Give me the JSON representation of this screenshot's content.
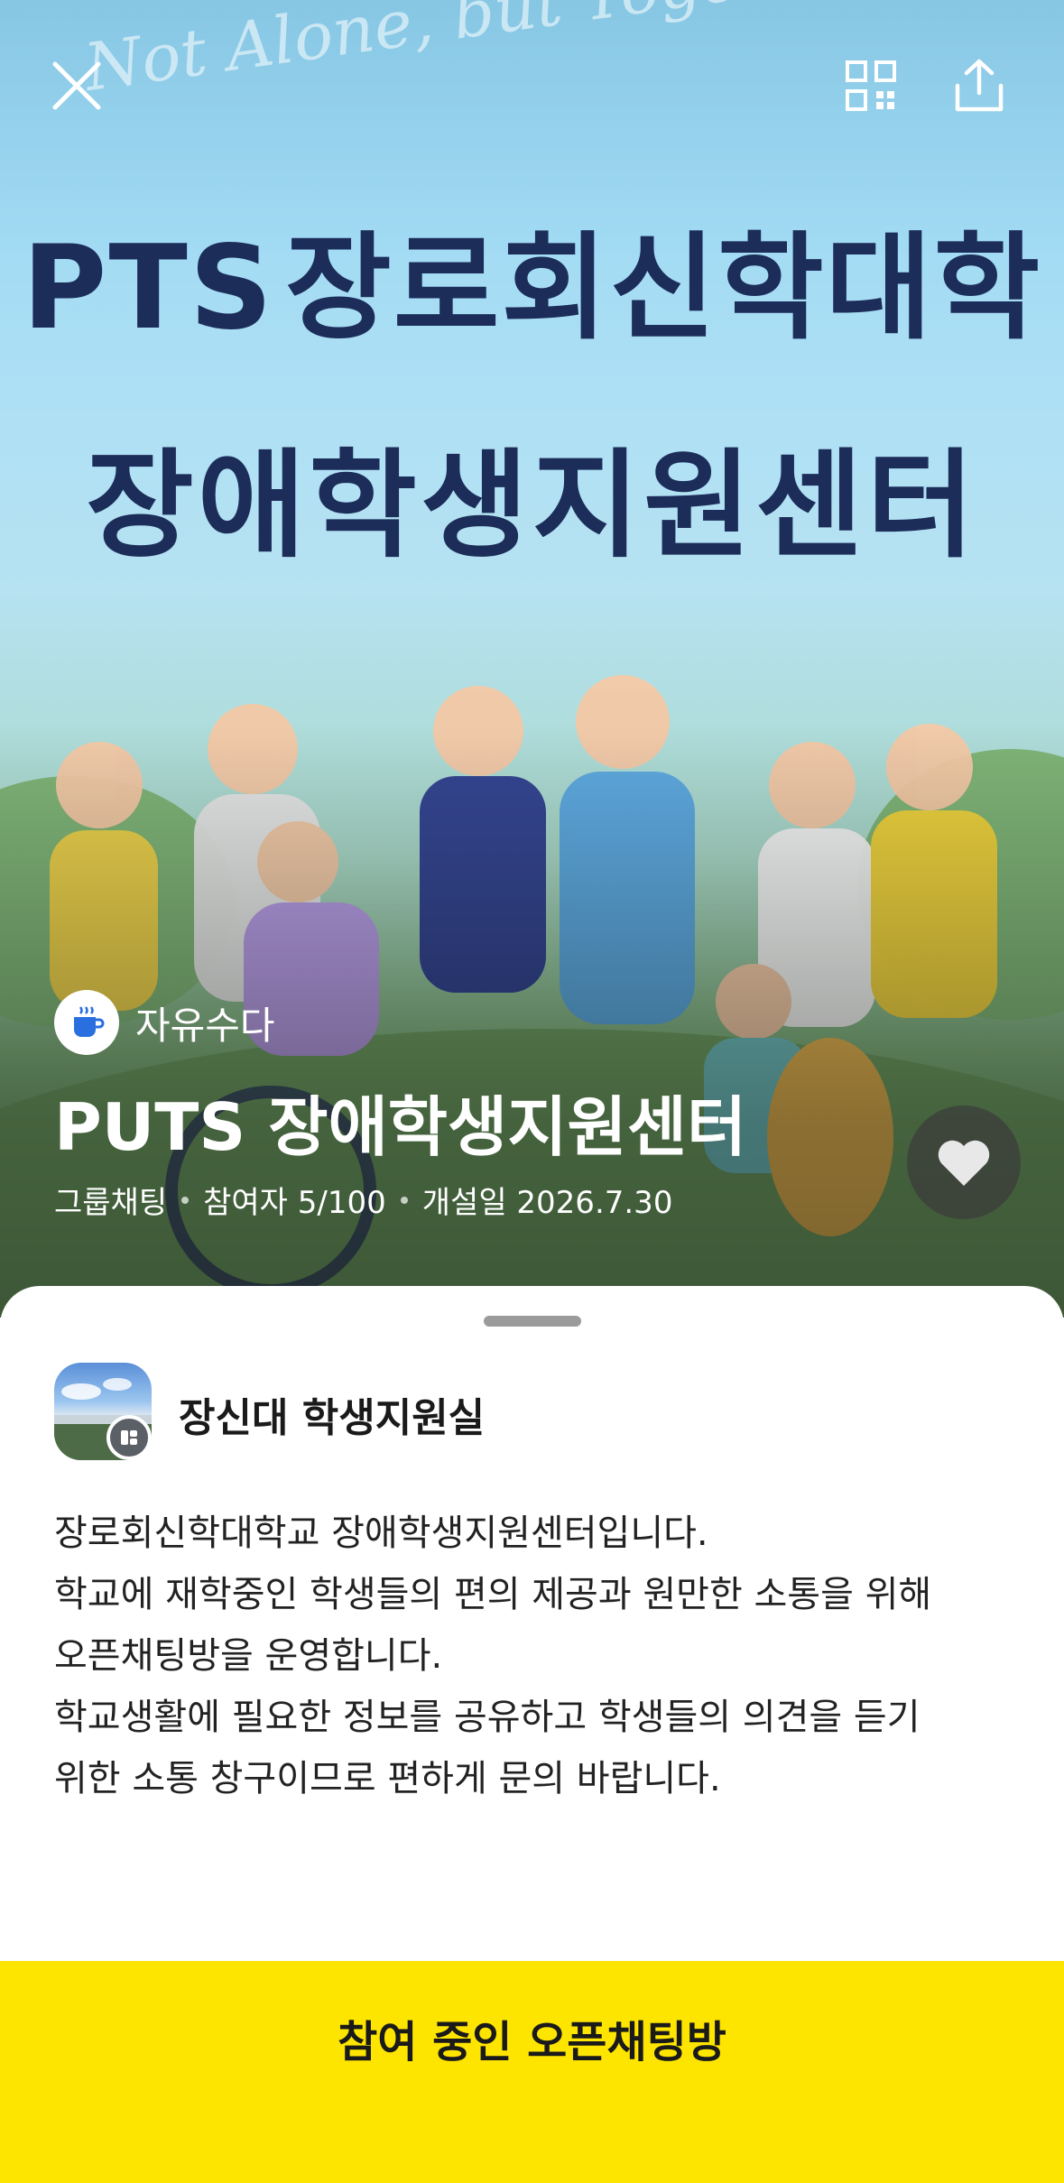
{
  "hero": {
    "script_text": "Not Alone, but Together!",
    "banner_line1": "장로회신학대학",
    "banner_line2": "장애학생지원센터",
    "banner_logo": "PTS"
  },
  "topbar": {
    "close_icon": "close-icon",
    "qr_icon": "qr-code-icon",
    "share_icon": "share-icon"
  },
  "room": {
    "category": "자유수다",
    "category_icon": "coffee-cup-icon",
    "title": "PUTS 장애학생지원센터",
    "meta": {
      "type": "그룹채팅",
      "participants": "참여자 5/100",
      "opened": "개설일 2026.7.30"
    },
    "like_icon": "heart-icon"
  },
  "host": {
    "name": "장신대 학생지원실",
    "badge_icon": "page-badge-icon"
  },
  "description": [
    "장로회신학대학교 장애학생지원센터입니다.",
    "학교에 재학중인 학생들의 편의 제공과 원만한 소통을 위해",
    "오픈채팅방을 운영합니다.",
    "학교생활에 필요한 정보를 공유하고 학생들의 의견을 듣기",
    "위한 소통 창구이므로 편하게 문의 바랍니다."
  ],
  "join_button": {
    "label": "참여 중인 오픈채팅방"
  },
  "colors": {
    "accent_yellow": "#fee500",
    "banner_navy": "#1c2d5a",
    "sky": "#aee0f5"
  }
}
